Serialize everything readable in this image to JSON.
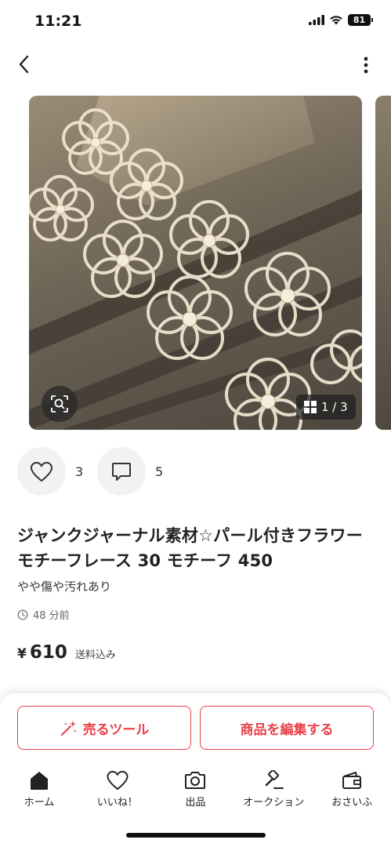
{
  "status_bar": {
    "time": "11:21",
    "battery": "81"
  },
  "item": {
    "page_indicator": "1 / 3",
    "likes": "3",
    "comments": "5",
    "title": "ジャンクジャーナル素材☆パール付きフラワーモチーフレース 30 モチーフ 450",
    "condition": "やや傷や汚れあり",
    "posted": "48 分前",
    "price_symbol": "¥",
    "price": "610",
    "shipping_note": "送料込み"
  },
  "actions": {
    "sell_tool": "売るツール",
    "edit_item": "商品を編集する"
  },
  "tabbar": {
    "items": [
      {
        "label": "ホーム",
        "icon": "home-icon"
      },
      {
        "label": "いいね！",
        "icon": "heart-icon"
      },
      {
        "label": "出品",
        "icon": "camera-icon"
      },
      {
        "label": "オークション",
        "icon": "gavel-icon"
      },
      {
        "label": "おさいふ",
        "icon": "wallet-icon"
      }
    ]
  },
  "colors": {
    "accent": "#e8404a",
    "text": "#222222"
  }
}
